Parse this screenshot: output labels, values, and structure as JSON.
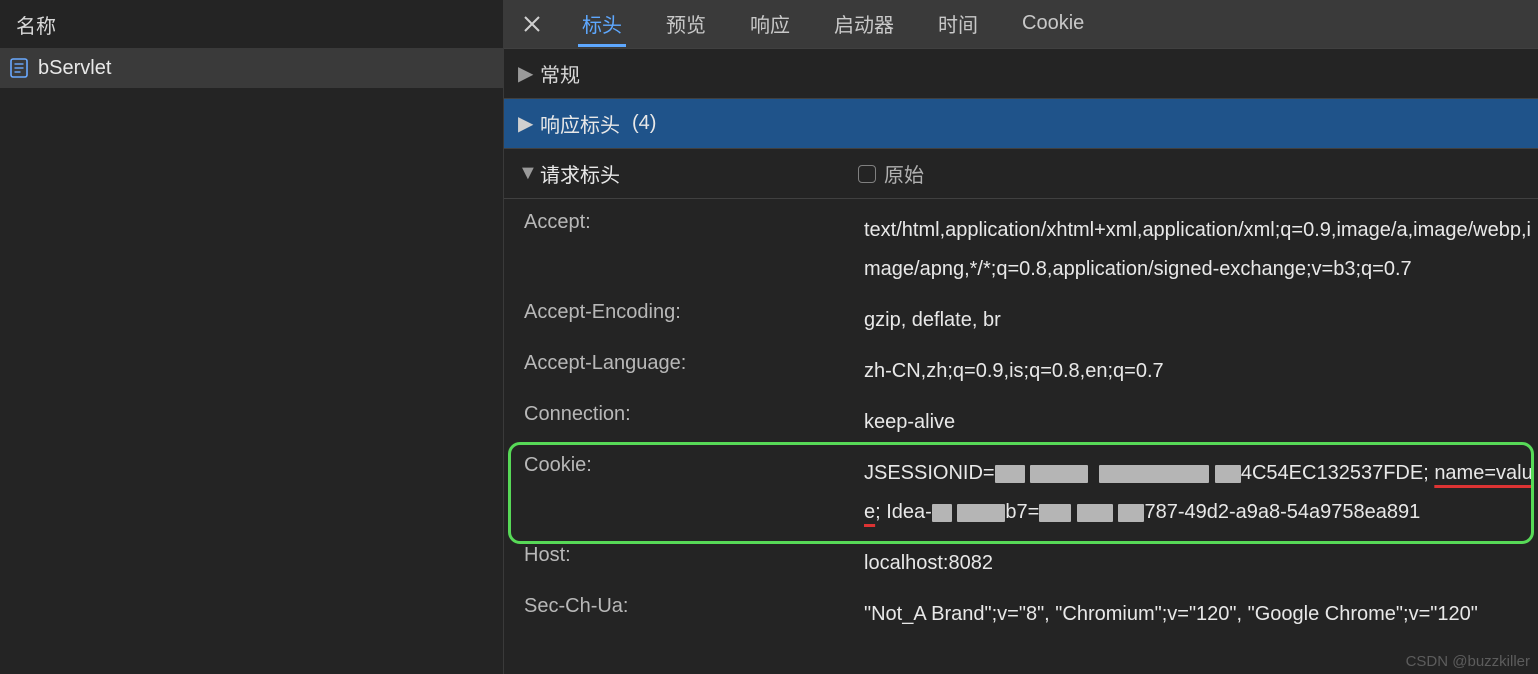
{
  "left": {
    "header": "名称",
    "rows": [
      "bServlet"
    ]
  },
  "tabs": {
    "items": [
      "标头",
      "预览",
      "响应",
      "启动器",
      "时间",
      "Cookie"
    ],
    "active_index": 0
  },
  "sections": {
    "general": {
      "label": "常规"
    },
    "response": {
      "label": "响应标头",
      "count": "(4)"
    },
    "request": {
      "label": "请求标头",
      "raw_label": "原始"
    }
  },
  "request_headers": [
    {
      "name": "Accept:",
      "value": "text/html,application/xhtml+xml,application/xml;q=0.9,image/a​,image/webp,image/apng,*/*;q=0.8,application/signed-exchange;v=b3;q=0.7"
    },
    {
      "name": "Accept-Encoding:",
      "value": "gzip, deflate, br"
    },
    {
      "name": "Accept-Language:",
      "value": "zh-CN,zh;q=0.9,is;q=0.8,en;q=0.7"
    },
    {
      "name": "Connection:",
      "value": "keep-alive"
    },
    {
      "name": "Cookie:",
      "value_parts": {
        "pre": "JSESSIONID=",
        "mid": "4C54EC132537FDE; ",
        "nv": "name=value",
        "after_nv": "; Idea-",
        "mid2_a": "b7=",
        "mid2_b": "787-49d2-a9a8-54a9758ea891"
      }
    },
    {
      "name": "Host:",
      "value": "localhost:8082"
    },
    {
      "name": "Sec-Ch-Ua:",
      "value": "\"Not_A Brand\";v=\"8\", \"Chromium\";v=\"120\", \"Google Chrome\";v=\"120\""
    }
  ],
  "watermark": "CSDN @buzzkiller"
}
